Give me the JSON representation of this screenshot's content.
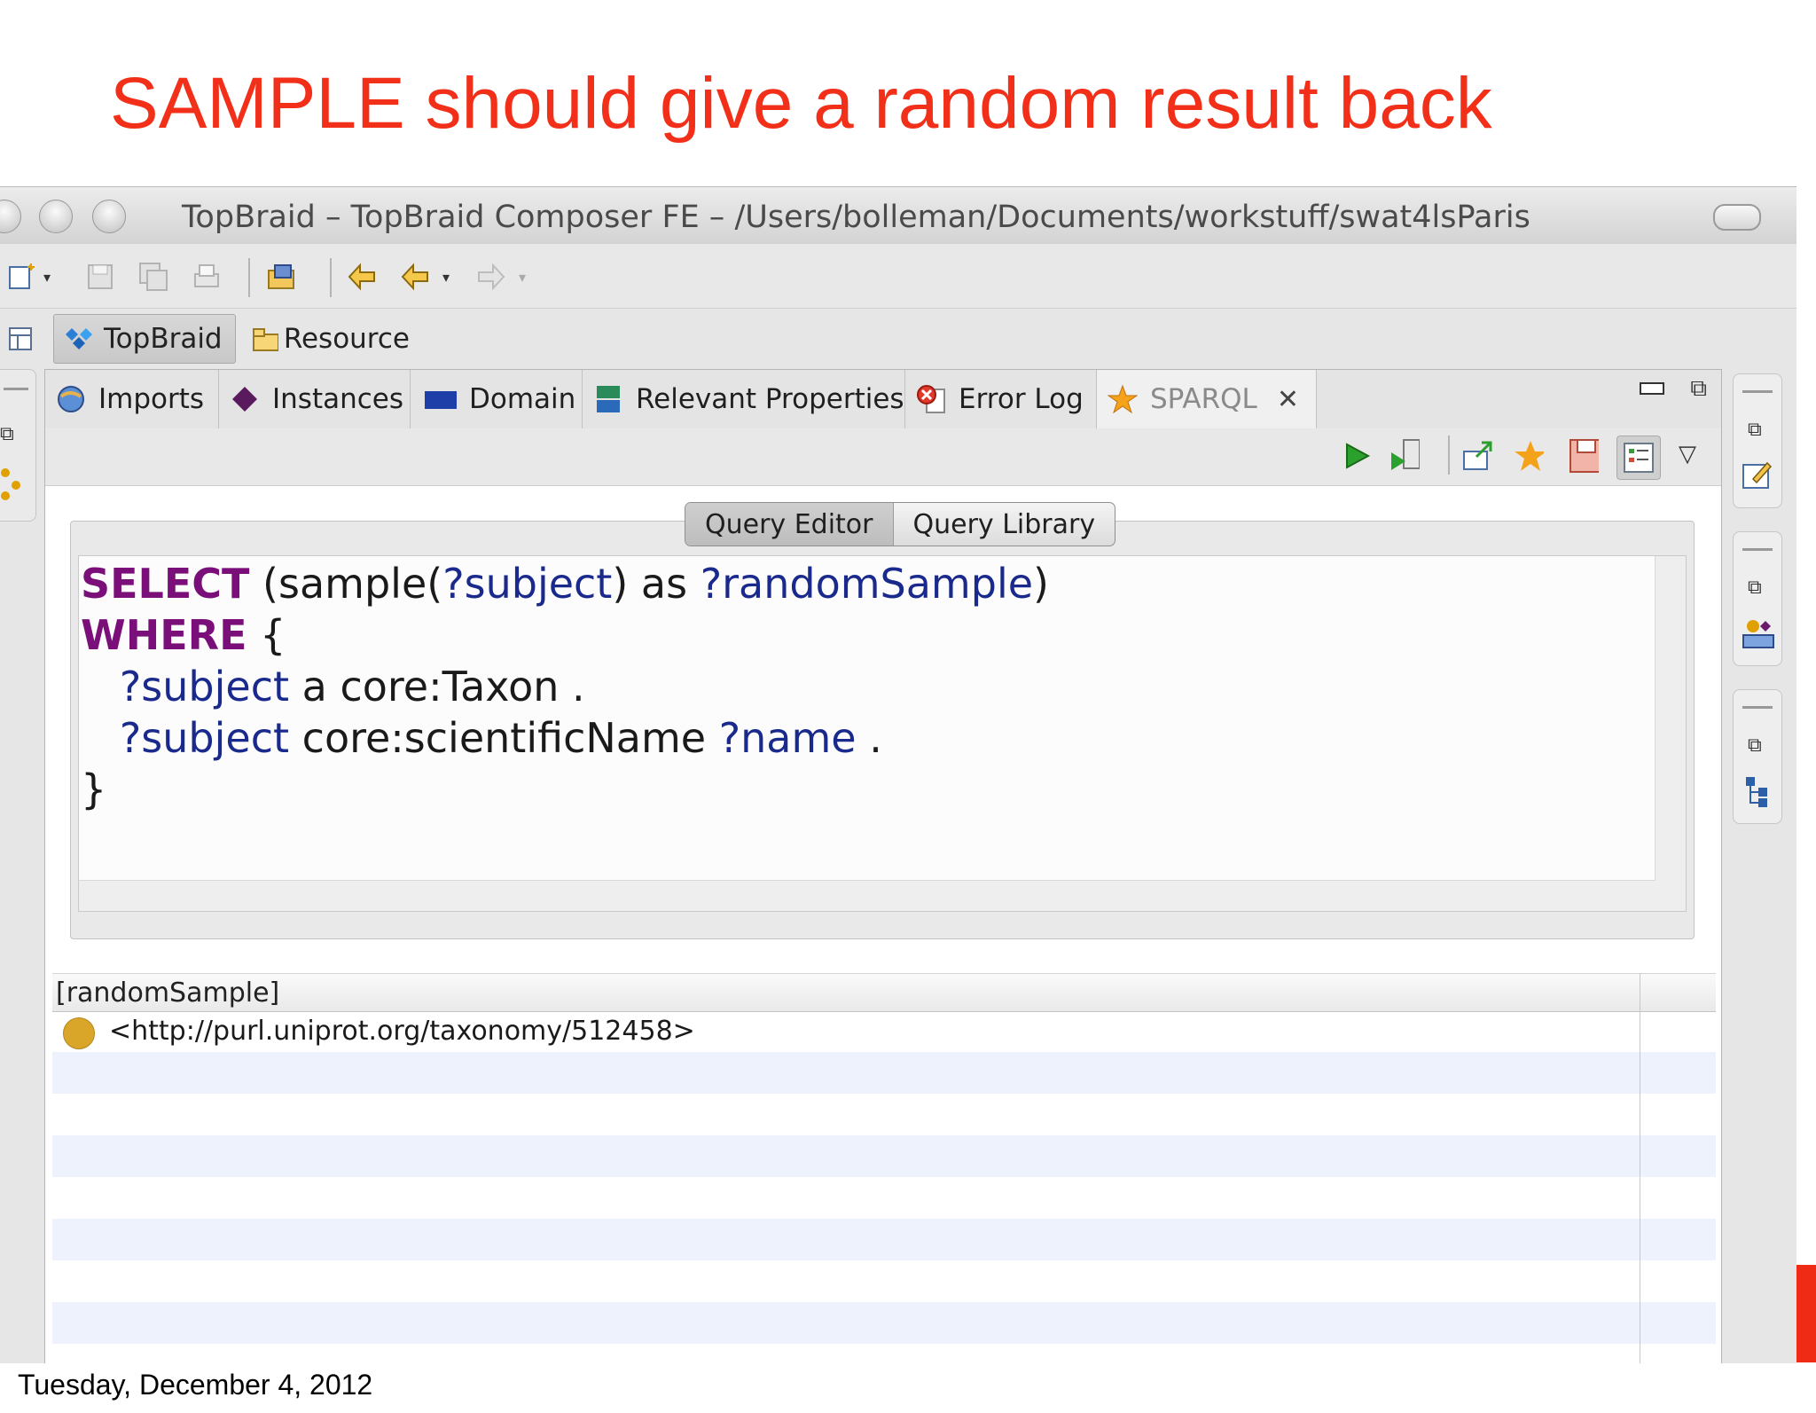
{
  "slide": {
    "title": "SAMPLE should give a random result back",
    "footer_date": "Tuesday, December 4, 2012"
  },
  "window": {
    "title": "TopBraid – TopBraid Composer FE – /Users/bolleman/Documents/workstuff/swat4lsParis"
  },
  "perspectives": [
    {
      "label": "TopBraid",
      "active": true
    },
    {
      "label": "Resource",
      "active": false
    }
  ],
  "tabs": [
    {
      "label": "Imports",
      "icon": "imports-icon"
    },
    {
      "label": "Instances",
      "icon": "diamond-icon"
    },
    {
      "label": "Domain",
      "icon": "domain-icon"
    },
    {
      "label": "Relevant Properties",
      "icon": "properties-icon"
    },
    {
      "label": "Error Log",
      "icon": "error-log-icon"
    },
    {
      "label": "SPARQL",
      "icon": "star-icon",
      "active": true,
      "closable": true
    }
  ],
  "editor": {
    "segments": [
      "Query Editor",
      "Query Library"
    ],
    "selected_segment": "Query Editor",
    "query_lines": [
      {
        "tokens": [
          {
            "t": "SELECT",
            "c": "kw"
          },
          {
            "t": " (sample(",
            "c": ""
          },
          {
            "t": "?subject",
            "c": "var"
          },
          {
            "t": ") as ",
            "c": ""
          },
          {
            "t": "?randomSample",
            "c": "var"
          },
          {
            "t": ")",
            "c": ""
          }
        ]
      },
      {
        "tokens": [
          {
            "t": "WHERE",
            "c": "kw"
          },
          {
            "t": " {",
            "c": ""
          }
        ]
      },
      {
        "tokens": [
          {
            "t": "   ",
            "c": ""
          },
          {
            "t": "?subject",
            "c": "var"
          },
          {
            "t": " a core:Taxon .",
            "c": ""
          }
        ]
      },
      {
        "tokens": [
          {
            "t": "   ",
            "c": ""
          },
          {
            "t": "?subject",
            "c": "var"
          },
          {
            "t": " core:scientificName ",
            "c": ""
          },
          {
            "t": "?name",
            "c": "var"
          },
          {
            "t": " .",
            "c": ""
          }
        ]
      },
      {
        "tokens": [
          {
            "t": "}",
            "c": ""
          }
        ]
      }
    ]
  },
  "results": {
    "column_header": "[randomSample]",
    "rows": [
      "<http://purl.uniprot.org/taxonomy/512458>"
    ]
  },
  "colors": {
    "title_red": "#f2301a",
    "keyword": "#7a0f7a",
    "variable": "#1a2a8c",
    "row_alt": "#edf2fc"
  }
}
